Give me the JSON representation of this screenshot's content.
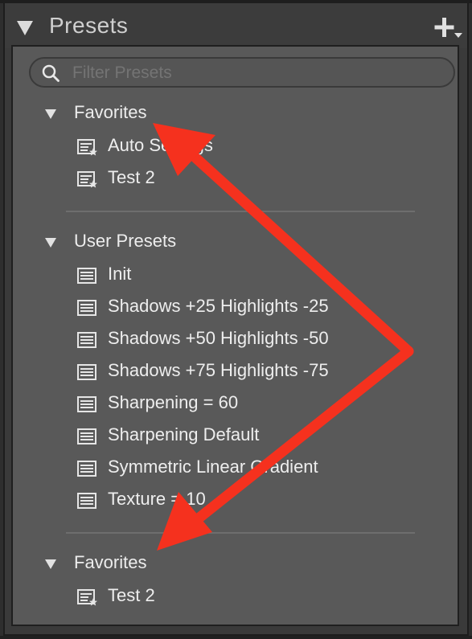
{
  "panel": {
    "title": "Presets",
    "search_placeholder": "Filter Presets"
  },
  "groups": [
    {
      "label": "Favorites",
      "items": [
        {
          "label": "Auto Settings",
          "icon": "favorite-preset-icon"
        },
        {
          "label": "Test 2",
          "icon": "favorite-preset-icon"
        }
      ]
    },
    {
      "label": "User Presets",
      "items": [
        {
          "label": "Init",
          "icon": "preset-icon"
        },
        {
          "label": "Shadows +25 Highlights -25",
          "icon": "preset-icon"
        },
        {
          "label": "Shadows +50 Highlights -50",
          "icon": "preset-icon"
        },
        {
          "label": "Shadows +75 Highlights -75",
          "icon": "preset-icon"
        },
        {
          "label": "Sharpening = 60",
          "icon": "preset-icon"
        },
        {
          "label": "Sharpening Default",
          "icon": "preset-icon"
        },
        {
          "label": "Symmetric Linear Gradient",
          "icon": "preset-icon"
        },
        {
          "label": "Texture = 10",
          "icon": "preset-icon"
        }
      ]
    },
    {
      "label": "Favorites",
      "items": [
        {
          "label": "Test 2",
          "icon": "favorite-preset-icon"
        }
      ]
    }
  ],
  "colors": {
    "panel_bg": "#595959",
    "header_bg": "#3c3c3c",
    "annotation_arrow": "#f5311e"
  }
}
